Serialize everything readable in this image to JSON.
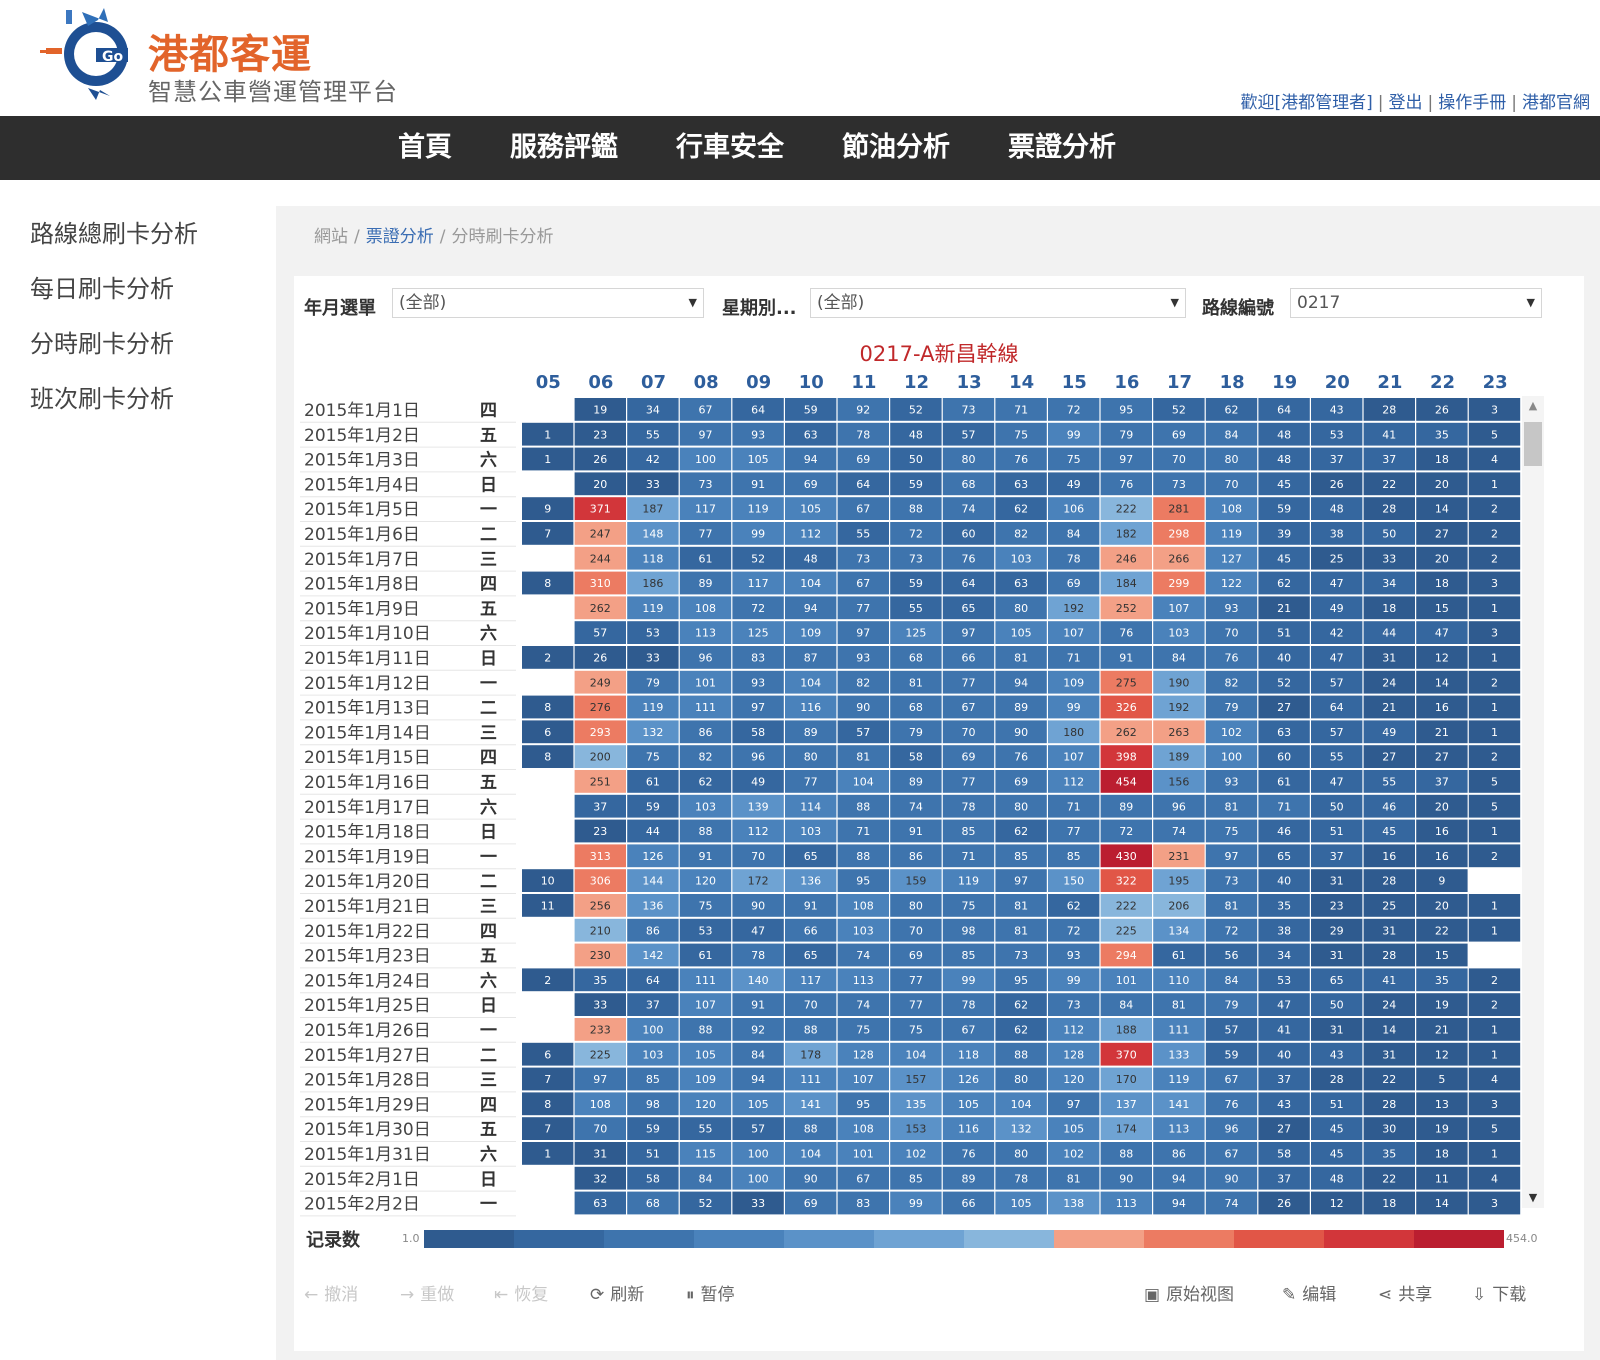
{
  "header": {
    "brand_name": "港都客運",
    "brand_sub": "智慧公車營運管理平台",
    "logo_text": "Go",
    "links": [
      "歡迎[港都管理者]",
      "登出",
      "操作手冊",
      "港都官網"
    ]
  },
  "nav": [
    "首頁",
    "服務評鑑",
    "行車安全",
    "節油分析",
    "票證分析"
  ],
  "sidebar": [
    "路線總刷卡分析",
    "每日刷卡分析",
    "分時刷卡分析",
    "班次刷卡分析"
  ],
  "breadcrumb": {
    "home": "網站",
    "section": "票證分析",
    "current": "分時刷卡分析"
  },
  "filters": [
    {
      "label": "年月選單",
      "value": "(全部)"
    },
    {
      "label": "星期別...",
      "value": "(全部)"
    },
    {
      "label": "路線編號",
      "value": "0217"
    }
  ],
  "chart_data": {
    "type": "heatmap",
    "title": "0217-A新昌幹線",
    "hours": [
      "05",
      "06",
      "07",
      "08",
      "09",
      "10",
      "11",
      "12",
      "13",
      "14",
      "15",
      "16",
      "17",
      "18",
      "19",
      "20",
      "21",
      "22",
      "23"
    ],
    "rows": [
      {
        "date": "2015年1月1日",
        "dow": "四",
        "values": [
          null,
          19,
          34,
          67,
          64,
          59,
          92,
          52,
          73,
          71,
          72,
          95,
          52,
          62,
          64,
          43,
          28,
          26,
          3
        ]
      },
      {
        "date": "2015年1月2日",
        "dow": "五",
        "values": [
          1,
          23,
          55,
          97,
          93,
          63,
          78,
          48,
          57,
          75,
          99,
          79,
          69,
          84,
          48,
          53,
          41,
          35,
          5
        ]
      },
      {
        "date": "2015年1月3日",
        "dow": "六",
        "values": [
          1,
          26,
          42,
          100,
          105,
          94,
          69,
          50,
          80,
          76,
          75,
          97,
          70,
          80,
          48,
          37,
          37,
          18,
          4
        ]
      },
      {
        "date": "2015年1月4日",
        "dow": "日",
        "values": [
          null,
          20,
          33,
          73,
          91,
          69,
          64,
          59,
          68,
          63,
          49,
          76,
          73,
          70,
          45,
          26,
          22,
          20,
          1
        ]
      },
      {
        "date": "2015年1月5日",
        "dow": "一",
        "values": [
          9,
          371,
          187,
          117,
          119,
          105,
          67,
          88,
          74,
          62,
          106,
          222,
          281,
          108,
          59,
          48,
          28,
          14,
          2
        ]
      },
      {
        "date": "2015年1月6日",
        "dow": "二",
        "values": [
          7,
          247,
          148,
          77,
          99,
          112,
          55,
          72,
          60,
          82,
          84,
          182,
          298,
          119,
          39,
          38,
          50,
          27,
          2
        ]
      },
      {
        "date": "2015年1月7日",
        "dow": "三",
        "values": [
          null,
          244,
          118,
          61,
          52,
          48,
          73,
          73,
          76,
          103,
          78,
          246,
          266,
          127,
          45,
          25,
          33,
          20,
          2
        ]
      },
      {
        "date": "2015年1月8日",
        "dow": "四",
        "values": [
          8,
          310,
          186,
          89,
          117,
          104,
          67,
          59,
          64,
          63,
          69,
          184,
          299,
          122,
          62,
          47,
          34,
          18,
          3
        ]
      },
      {
        "date": "2015年1月9日",
        "dow": "五",
        "values": [
          null,
          262,
          119,
          108,
          72,
          94,
          77,
          55,
          65,
          80,
          192,
          252,
          107,
          93,
          21,
          49,
          18,
          15,
          1
        ]
      },
      {
        "date": "2015年1月10日",
        "dow": "六",
        "values": [
          null,
          57,
          53,
          113,
          125,
          109,
          97,
          125,
          97,
          105,
          107,
          76,
          103,
          70,
          51,
          42,
          44,
          47,
          3
        ]
      },
      {
        "date": "2015年1月11日",
        "dow": "日",
        "values": [
          2,
          26,
          33,
          96,
          83,
          87,
          93,
          68,
          66,
          81,
          71,
          91,
          84,
          76,
          40,
          47,
          31,
          12,
          1
        ]
      },
      {
        "date": "2015年1月12日",
        "dow": "一",
        "values": [
          null,
          249,
          79,
          101,
          93,
          104,
          82,
          81,
          77,
          94,
          109,
          275,
          190,
          82,
          52,
          57,
          24,
          14,
          2
        ]
      },
      {
        "date": "2015年1月13日",
        "dow": "二",
        "values": [
          8,
          276,
          119,
          111,
          97,
          116,
          90,
          68,
          67,
          89,
          99,
          326,
          192,
          79,
          27,
          64,
          21,
          16,
          1
        ]
      },
      {
        "date": "2015年1月14日",
        "dow": "三",
        "values": [
          6,
          293,
          132,
          86,
          58,
          89,
          57,
          79,
          70,
          90,
          180,
          262,
          263,
          102,
          63,
          57,
          49,
          21,
          1
        ]
      },
      {
        "date": "2015年1月15日",
        "dow": "四",
        "values": [
          8,
          200,
          75,
          82,
          96,
          80,
          81,
          58,
          69,
          76,
          107,
          398,
          189,
          100,
          60,
          55,
          27,
          27,
          2
        ]
      },
      {
        "date": "2015年1月16日",
        "dow": "五",
        "values": [
          null,
          251,
          61,
          62,
          49,
          77,
          104,
          89,
          77,
          69,
          112,
          454,
          156,
          93,
          61,
          47,
          55,
          37,
          5
        ]
      },
      {
        "date": "2015年1月17日",
        "dow": "六",
        "values": [
          null,
          37,
          59,
          103,
          139,
          114,
          88,
          74,
          78,
          80,
          71,
          89,
          96,
          81,
          71,
          50,
          46,
          20,
          5
        ]
      },
      {
        "date": "2015年1月18日",
        "dow": "日",
        "values": [
          null,
          23,
          44,
          88,
          112,
          103,
          71,
          91,
          85,
          62,
          77,
          72,
          74,
          75,
          46,
          51,
          45,
          16,
          1
        ]
      },
      {
        "date": "2015年1月19日",
        "dow": "一",
        "values": [
          null,
          313,
          126,
          91,
          70,
          65,
          88,
          86,
          71,
          85,
          85,
          430,
          231,
          97,
          65,
          37,
          16,
          16,
          2
        ]
      },
      {
        "date": "2015年1月20日",
        "dow": "二",
        "values": [
          10,
          306,
          144,
          120,
          172,
          136,
          95,
          159,
          119,
          97,
          150,
          322,
          195,
          73,
          40,
          31,
          28,
          9,
          null
        ]
      },
      {
        "date": "2015年1月21日",
        "dow": "三",
        "values": [
          11,
          256,
          136,
          75,
          90,
          91,
          108,
          80,
          75,
          81,
          62,
          222,
          206,
          81,
          35,
          23,
          25,
          20,
          1
        ]
      },
      {
        "date": "2015年1月22日",
        "dow": "四",
        "values": [
          null,
          210,
          86,
          53,
          47,
          66,
          103,
          70,
          98,
          81,
          72,
          225,
          134,
          72,
          38,
          29,
          31,
          22,
          1
        ]
      },
      {
        "date": "2015年1月23日",
        "dow": "五",
        "values": [
          null,
          230,
          142,
          61,
          78,
          65,
          74,
          69,
          85,
          73,
          93,
          294,
          61,
          56,
          34,
          31,
          28,
          15,
          null
        ]
      },
      {
        "date": "2015年1月24日",
        "dow": "六",
        "values": [
          2,
          35,
          64,
          111,
          140,
          117,
          113,
          77,
          99,
          95,
          99,
          101,
          110,
          84,
          53,
          65,
          41,
          35,
          2
        ]
      },
      {
        "date": "2015年1月25日",
        "dow": "日",
        "values": [
          null,
          33,
          37,
          107,
          91,
          70,
          74,
          77,
          78,
          62,
          73,
          84,
          81,
          79,
          47,
          50,
          24,
          19,
          2
        ]
      },
      {
        "date": "2015年1月26日",
        "dow": "一",
        "values": [
          null,
          233,
          100,
          88,
          92,
          88,
          75,
          75,
          67,
          62,
          112,
          188,
          111,
          57,
          41,
          31,
          14,
          21,
          1
        ]
      },
      {
        "date": "2015年1月27日",
        "dow": "二",
        "values": [
          6,
          225,
          103,
          105,
          84,
          178,
          128,
          104,
          118,
          88,
          128,
          370,
          133,
          59,
          40,
          43,
          31,
          12,
          1
        ]
      },
      {
        "date": "2015年1月28日",
        "dow": "三",
        "values": [
          7,
          97,
          85,
          109,
          94,
          111,
          107,
          157,
          126,
          80,
          120,
          170,
          119,
          67,
          37,
          28,
          22,
          5,
          4
        ]
      },
      {
        "date": "2015年1月29日",
        "dow": "四",
        "values": [
          8,
          108,
          98,
          120,
          105,
          141,
          95,
          135,
          105,
          104,
          97,
          137,
          141,
          76,
          43,
          51,
          28,
          13,
          3
        ]
      },
      {
        "date": "2015年1月30日",
        "dow": "五",
        "values": [
          7,
          70,
          59,
          55,
          57,
          88,
          108,
          153,
          116,
          132,
          105,
          174,
          113,
          96,
          27,
          45,
          30,
          19,
          5
        ]
      },
      {
        "date": "2015年1月31日",
        "dow": "六",
        "values": [
          1,
          31,
          51,
          115,
          100,
          104,
          101,
          102,
          76,
          80,
          102,
          88,
          86,
          67,
          58,
          45,
          35,
          18,
          1
        ]
      },
      {
        "date": "2015年2月1日",
        "dow": "日",
        "values": [
          null,
          32,
          58,
          84,
          100,
          90,
          67,
          85,
          89,
          78,
          81,
          90,
          94,
          90,
          37,
          48,
          22,
          11,
          4
        ]
      },
      {
        "date": "2015年2月2日",
        "dow": "一",
        "values": [
          null,
          63,
          68,
          52,
          33,
          69,
          83,
          99,
          66,
          105,
          138,
          113,
          94,
          74,
          26,
          12,
          18,
          14,
          3
        ]
      }
    ],
    "legend": {
      "label": "记录数",
      "min": "1.0",
      "max": "454.0",
      "min_value": 1,
      "max_value": 454
    },
    "colors": [
      "#2f5b8f",
      "#35679f",
      "#3e74ad",
      "#4a82bb",
      "#5b92c8",
      "#6fa3d3",
      "#88b6dc",
      "#f3a086",
      "#ec7b62",
      "#e15647",
      "#d2363a",
      "#bb1e30"
    ]
  },
  "toolbar": {
    "undo": "撤消",
    "redo": "重做",
    "revert": "恢复",
    "refresh": "刷新",
    "pause": "暂停",
    "original_view": "原始视图",
    "edit": "编辑",
    "share": "共享",
    "download": "下载"
  }
}
